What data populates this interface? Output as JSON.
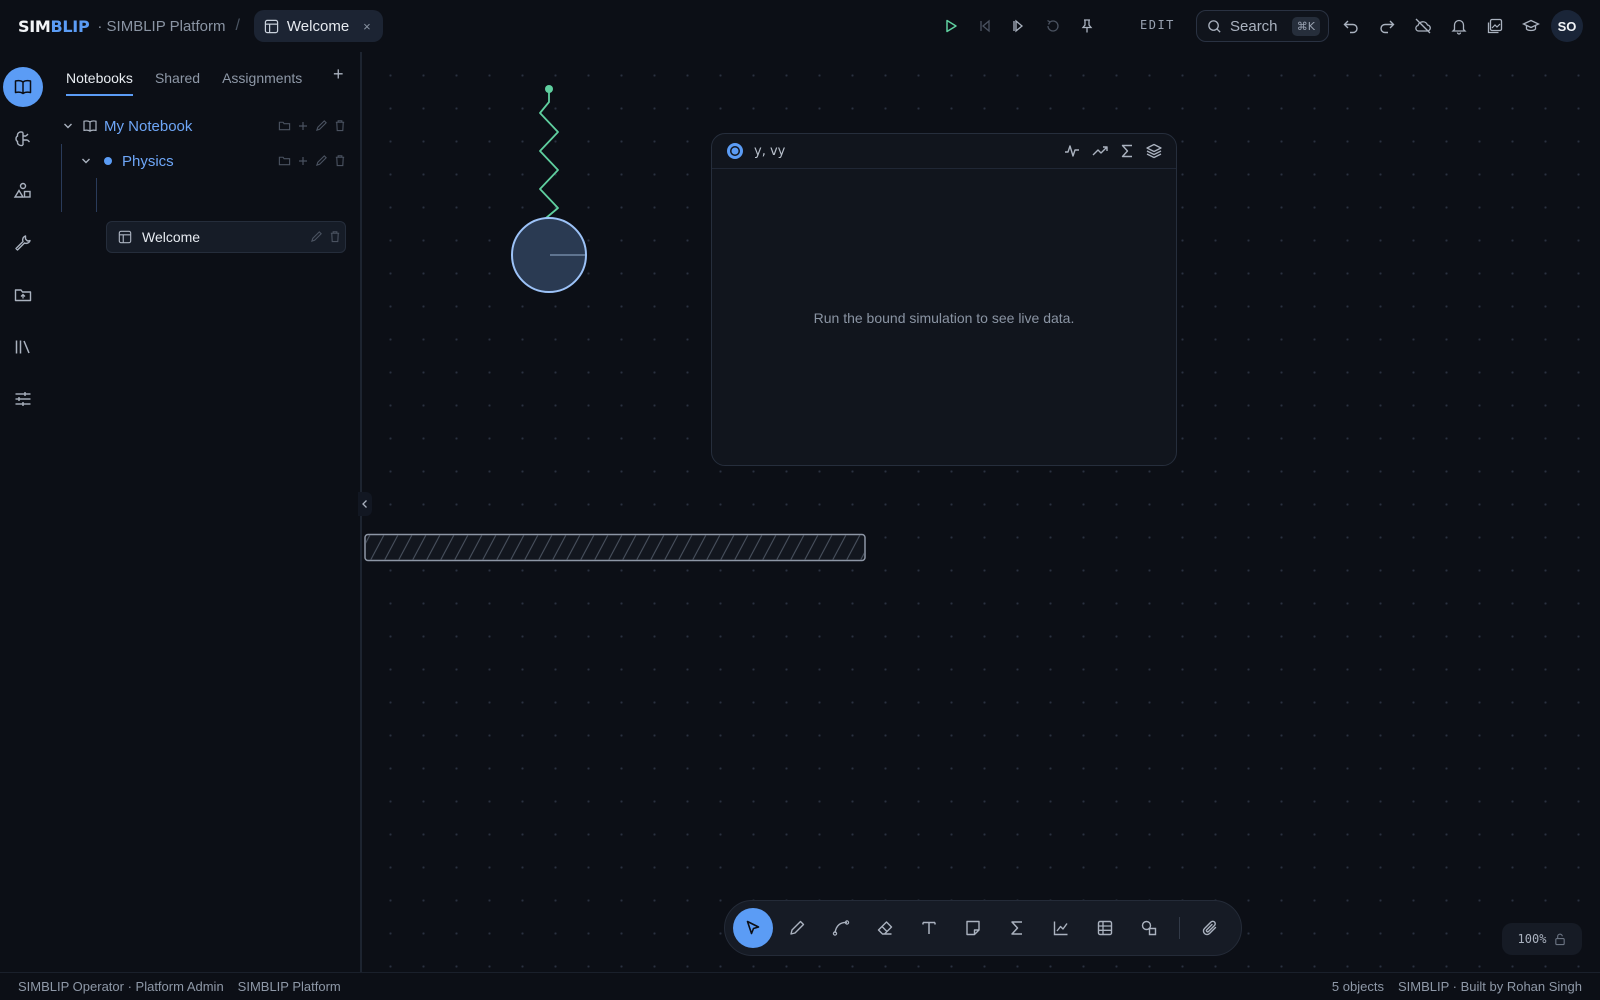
{
  "topbar": {
    "logo_white": "SIM",
    "logo_blue": "BLIP",
    "platform": "· SIMBLIP Platform",
    "separator": "/",
    "tab_label": "Welcome",
    "tab_close": "×",
    "mode": "EDIT",
    "search_label": "Search",
    "search_shortcut": "⌘K",
    "avatar_initials": "SO"
  },
  "sidebar": {
    "tabs": [
      "Notebooks",
      "Shared",
      "Assignments"
    ],
    "active_tab": "Notebooks",
    "add": "+",
    "tree": {
      "notebook": "My Notebook",
      "folder": "Physics",
      "page": "Welcome"
    }
  },
  "canvas": {
    "graph_card": {
      "title": "y, vy",
      "empty_message": "Run the bound simulation to see live data."
    },
    "zoom": "100%"
  },
  "toolbar": {
    "tools": [
      "select",
      "pen",
      "curve",
      "eraser",
      "text",
      "note",
      "formula",
      "graph",
      "table",
      "shapes",
      "attach"
    ]
  },
  "statusbar": {
    "user": "SIMBLIP Operator · Platform Admin",
    "workspace": "SIMBLIP Platform",
    "objects": "5 objects",
    "credit": "SIMBLIP · Built by Rohan Singh"
  },
  "colors": {
    "accent": "#5b9cf5",
    "spring": "#5fcf9f",
    "background": "#0c0f16"
  }
}
